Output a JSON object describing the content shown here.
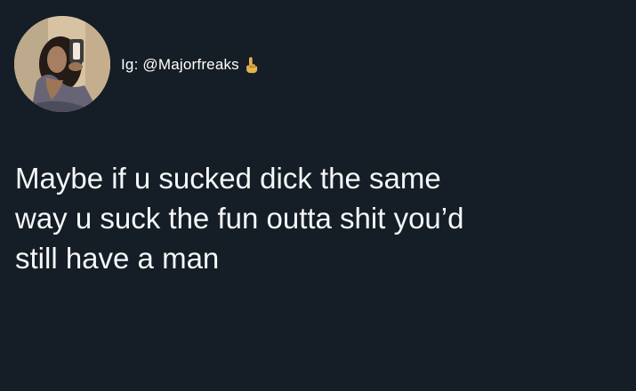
{
  "profile": {
    "handle": "Ig: @Majorfreaks",
    "avatar_icon": "profile-photo",
    "badge_icon": "middle-finger-emoji-icon"
  },
  "tweet": {
    "text": "Maybe if u sucked dick the same\nway u suck the fun outta shit you’d\nstill have a man"
  },
  "colors": {
    "background": "#151d26",
    "text": "#f5f7f8",
    "handle": "#ffffff",
    "emoji": "#e6b24c"
  }
}
